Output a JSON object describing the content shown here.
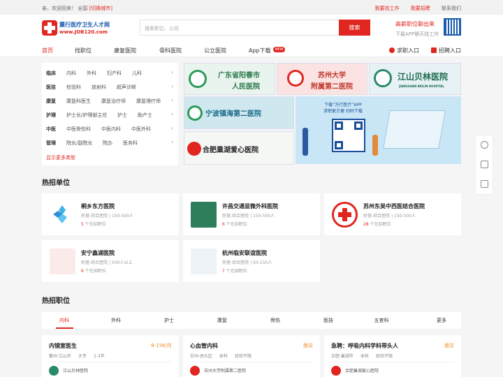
{
  "topbar": {
    "welcome": "亲，欢迎回来！",
    "city": "全国",
    "switch_city": "[切换城市]",
    "find_job": "我要找工作",
    "recruit": "我要招聘",
    "contact": "联系我们"
  },
  "header": {
    "logo_title": "薰行医疗卫生人才网",
    "logo_url": "www.JOB120.com",
    "search_placeholder": "搜索职位、公司",
    "search_button": "搜索",
    "promo_title": "高薪职位聊出来",
    "promo_sub": "下载APP聊天找工作"
  },
  "nav": {
    "items": [
      "首页",
      "找职位",
      "康复医院",
      "骨科医院",
      "公立医院",
      "App下载"
    ],
    "new_badge": "NEW",
    "job_login": "求职入口",
    "recruit_login": "招聘入口"
  },
  "categories": [
    {
      "head": "临床",
      "items": [
        "内科",
        "外科",
        "妇产科",
        "儿科"
      ]
    },
    {
      "head": "医技",
      "items": [
        "检验科",
        "放射科",
        "超声诊断"
      ]
    },
    {
      "head": "康复",
      "items": [
        "康复科医生",
        "康复治疗师",
        "康复理疗师"
      ]
    },
    {
      "head": "护理",
      "items": [
        "护士长/护理部主任",
        "护士",
        "助产士"
      ]
    },
    {
      "head": "中医",
      "items": [
        "中医骨伤科",
        "中医内科",
        "中医外科"
      ]
    },
    {
      "head": "管理",
      "items": [
        "院长/副院长",
        "院办",
        "医务科"
      ]
    }
  ],
  "categories_more": "显示更多类型",
  "banners": {
    "b1": "广东省阳春市人民医院",
    "b1a": "广东省阳春市",
    "b1b": "人民医院",
    "b2a": "苏州大学",
    "b2b": "附属第二医院",
    "b3a": "江山贝林医院",
    "b3b": "JIANGSHAN BEILIN HOSPITAL",
    "b4": "宁波镇海第二医院",
    "b5": "合肥巢湖爱心医院",
    "app_line1": "下载“万行医疗”APP",
    "app_line2": "求职更方便  扫码下载"
  },
  "hot_companies_title": "热招单位",
  "companies": [
    {
      "name": "桐乡东方医院",
      "meta": "民营-综合医院 | 150-500人",
      "count": "5",
      "count_suffix": "个在招职位"
    },
    {
      "name": "许昌交通显微外科医院",
      "meta": "民营-综合医院 | 150-500人",
      "count": "6",
      "count_suffix": "个在招职位"
    },
    {
      "name": "苏州东吴中西医结合医院",
      "meta": "民营-综合医院 | 150-500人",
      "count": "28",
      "count_suffix": "个在招职位"
    },
    {
      "name": "安宁鑫湖医院",
      "meta": "民营-综合医院 | 500人以上",
      "count": "6",
      "count_suffix": "个在招职位"
    },
    {
      "name": "杭州临安联谊医院",
      "meta": "民营-综合医院 | 50-150人",
      "count": "7",
      "count_suffix": "个在招职位"
    }
  ],
  "hot_jobs_title": "热招职位",
  "job_tabs": [
    "内科",
    "外科",
    "护士",
    "康复",
    "骨伤",
    "医技",
    "五官科",
    "更多"
  ],
  "jobs": [
    {
      "title": "内镜室医生",
      "salary": "8-15K/月",
      "city": "衢州·江山市",
      "edu": "大专",
      "exp": "1-3年",
      "company": "江山贝林医院"
    },
    {
      "title": "心血管内科",
      "salary": "面议",
      "city": "苏州·虎丘区",
      "edu": "本科",
      "exp": "经验不限",
      "company": "苏州大学附属第二医院"
    },
    {
      "title": "急聘：呼吸内科学科带头人",
      "salary": "面议",
      "city": "合肥·巢湖市",
      "edu": "本科",
      "exp": "经验不限",
      "company": "合肥巢湖爱心医院"
    }
  ],
  "colors": {
    "brand_red": "#e0261f",
    "brand_blue": "#1a5cb0",
    "salary_orange": "#f08a24"
  }
}
